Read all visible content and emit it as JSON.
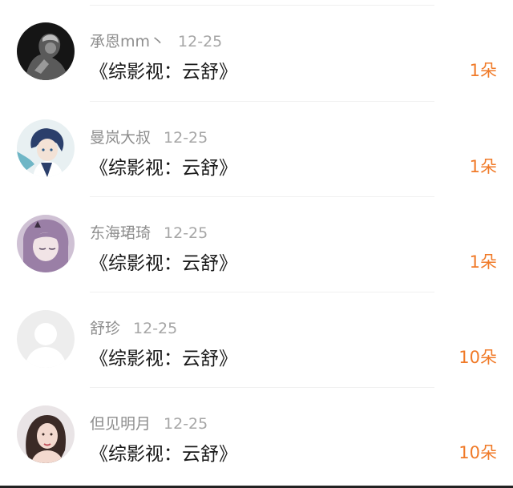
{
  "items": [
    {
      "name": "承恩mm丶",
      "date": "12-25",
      "title": "《综影视：云舒》",
      "count": "1朵",
      "avatar": "user-avatar-dark-portrait"
    },
    {
      "name": "曼岚大叔",
      "date": "12-25",
      "title": "《综影视：云舒》",
      "count": "1朵",
      "avatar": "user-avatar-anime-blue"
    },
    {
      "name": "东海珺琦",
      "date": "12-25",
      "title": "《综影视：云舒》",
      "count": "1朵",
      "avatar": "user-avatar-anime-purple"
    },
    {
      "name": "舒珍",
      "date": "12-25",
      "title": "《综影视：云舒》",
      "count": "10朵",
      "avatar": "default-avatar"
    },
    {
      "name": "但见明月",
      "date": "12-25",
      "title": "《综影视：云舒》",
      "count": "10朵",
      "avatar": "user-avatar-photo"
    }
  ],
  "colors": {
    "accent": "#f07a28",
    "name_gray": "#8e8e8e",
    "title": "#1a1a1a",
    "divider": "#f0f0f0"
  }
}
